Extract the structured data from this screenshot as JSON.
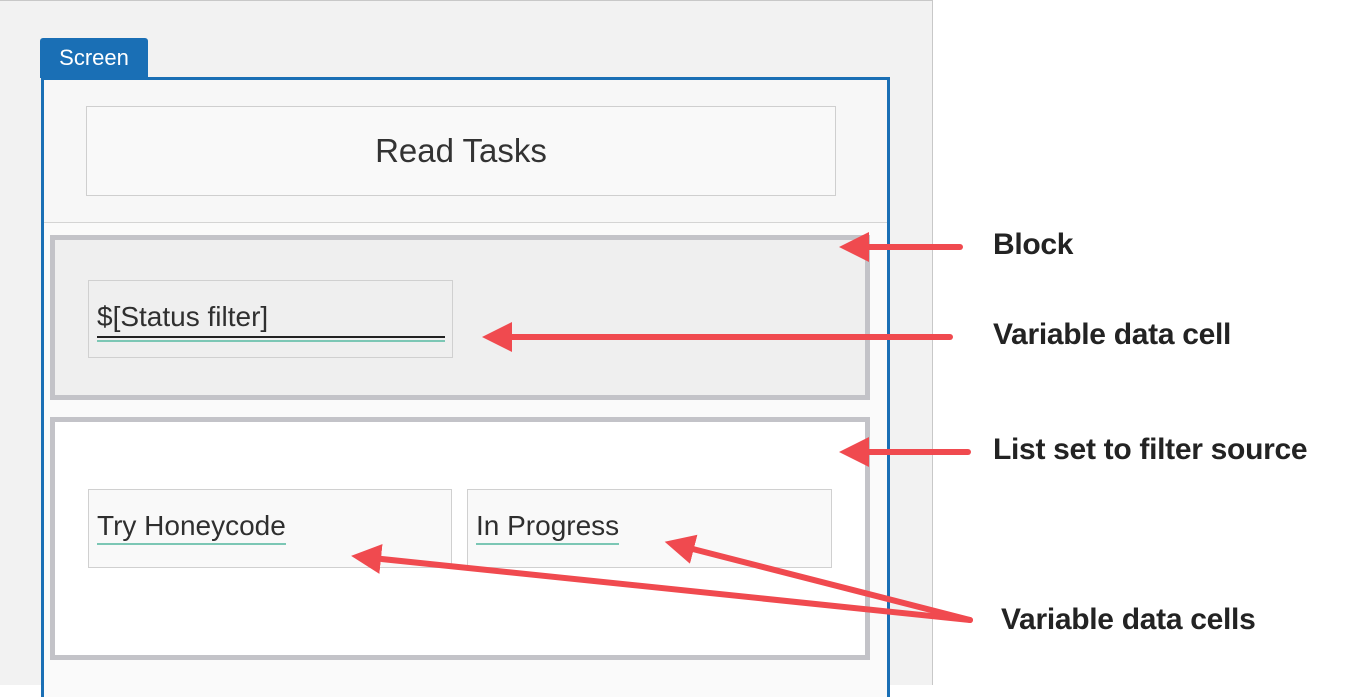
{
  "screen_tab": {
    "label": "Screen"
  },
  "header": {
    "title": "Read Tasks"
  },
  "block": {
    "filter_cell": {
      "value": "$[Status filter]"
    }
  },
  "list": {
    "row": {
      "name_cell": {
        "value": "Try Honeycode"
      },
      "status_cell": {
        "value": "In Progress"
      }
    }
  },
  "annotations": {
    "block": "Block",
    "variable_data_cell": "Variable data cell",
    "list_source": "List set to filter source",
    "variable_data_cells": "Variable data cells"
  },
  "colors": {
    "accent": "#1a6fb5",
    "arrow": "#f04a4f",
    "underline": "#7cc7b5",
    "block_border": "#c3c3c8"
  }
}
